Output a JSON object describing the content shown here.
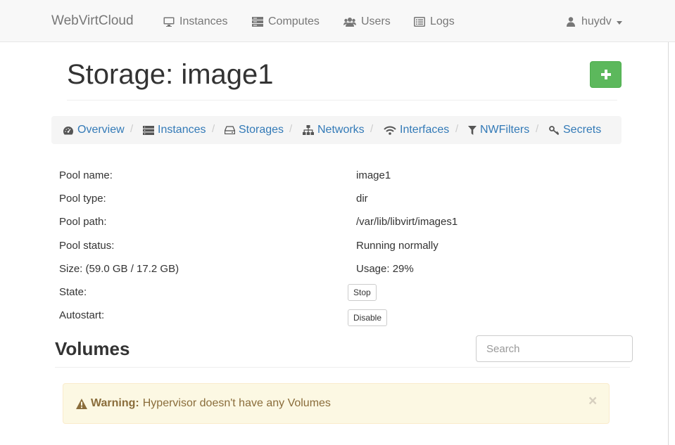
{
  "navbar": {
    "brand": "WebVirtCloud",
    "items": [
      {
        "label": "Instances",
        "icon": "desktop-icon"
      },
      {
        "label": "Computes",
        "icon": "server-icon"
      },
      {
        "label": "Users",
        "icon": "users-icon"
      },
      {
        "label": "Logs",
        "icon": "list-alt-icon"
      }
    ],
    "user": {
      "label": "huydv",
      "icon": "user-icon"
    }
  },
  "header": {
    "title": "Storage: image1",
    "add_label": "+"
  },
  "tabs": [
    {
      "label": "Overview",
      "icon": "dashboard-icon"
    },
    {
      "label": "Instances",
      "icon": "server-icon"
    },
    {
      "label": "Storages",
      "icon": "hdd-icon"
    },
    {
      "label": "Networks",
      "icon": "sitemap-icon"
    },
    {
      "label": "Interfaces",
      "icon": "wifi-icon"
    },
    {
      "label": "NWFilters",
      "icon": "filter-icon"
    },
    {
      "label": "Secrets",
      "icon": "key-icon"
    }
  ],
  "tab_separator": "/",
  "pool": {
    "name_label": "Pool name:",
    "name_value": "image1",
    "type_label": "Pool type:",
    "type_value": "dir",
    "path_label": "Pool path:",
    "path_value": "/var/lib/libvirt/images1",
    "status_label": "Pool status:",
    "status_value": "Running normally",
    "size_label": "Size: (59.0 GB / 17.2 GB)",
    "usage_value": "Usage: 29%",
    "state_label": "State:",
    "state_button": "Stop",
    "autostart_label": "Autostart:",
    "autostart_button": "Disable"
  },
  "volumes": {
    "title": "Volumes",
    "search_placeholder": "Search",
    "alert": {
      "strong": "Warning:",
      "message": "Hypervisor doesn't have any Volumes",
      "close": "×",
      "icon": "warning-icon"
    }
  },
  "colors": {
    "link": "#337ab7",
    "success": "#5cb85c",
    "warning_bg": "#fcf8e3",
    "warning_text": "#8a6d3b"
  }
}
